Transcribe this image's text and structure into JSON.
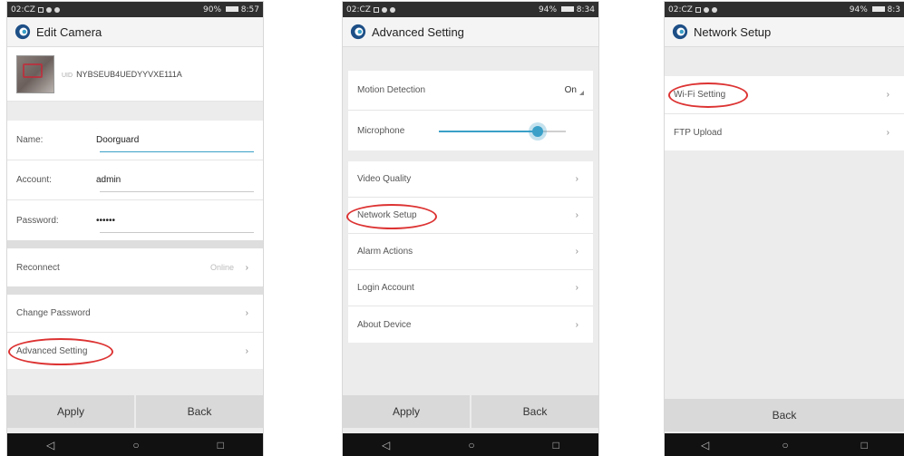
{
  "colors": {
    "accent": "#3aa0c8",
    "annotation": "#d33333"
  },
  "nav": {
    "back_icon": "back-triangle-icon",
    "home_icon": "home-circle-icon",
    "recents_icon": "recents-square-icon"
  },
  "screens": {
    "edit_camera": {
      "status": {
        "time_left": "02:CZ",
        "right": "8:57",
        "battery": "90%"
      },
      "title": "Edit Camera",
      "uid_prefix": "UID",
      "uid": "NYBSEUB4UEDYYVXE111A",
      "fields": {
        "name": {
          "label": "Name:",
          "value": "Doorguard"
        },
        "account": {
          "label": "Account:",
          "value": "admin"
        },
        "password": {
          "label": "Password:",
          "value": "••••••"
        }
      },
      "reconnect": {
        "label": "Reconnect",
        "status": "Online"
      },
      "change_password": "Change Password",
      "advanced_setting": "Advanced Setting",
      "apply": "Apply",
      "back": "Back"
    },
    "advanced_setting": {
      "status": {
        "time_left": "02:CZ",
        "right": "8:34",
        "battery": "94%"
      },
      "title": "Advanced Setting",
      "motion_detection": {
        "label": "Motion Detection",
        "value": "On"
      },
      "microphone": {
        "label": "Microphone",
        "level": 0.78
      },
      "items": [
        "Video Quality",
        "Network Setup",
        "Alarm Actions",
        "Login Account",
        "About Device"
      ],
      "apply": "Apply",
      "back": "Back"
    },
    "network_setup": {
      "status": {
        "time_left": "02:CZ",
        "right": "8:3",
        "battery": "94%"
      },
      "title": "Network Setup",
      "items": [
        "Wi-Fi Setting",
        "FTP Upload"
      ],
      "back": "Back"
    }
  }
}
